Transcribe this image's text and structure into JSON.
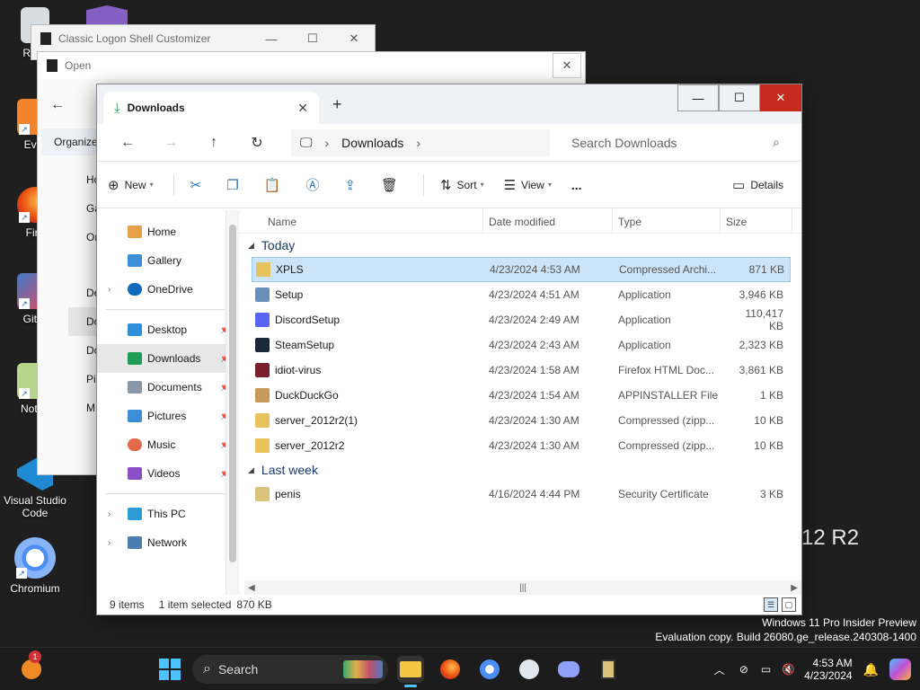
{
  "desktop": {
    "icons": [
      {
        "label": "Recy",
        "top": 0
      },
      {
        "label": "Ever",
        "top": 0
      },
      {
        "label": "Fire",
        "top": 0
      },
      {
        "label": "Git B",
        "top": 0
      },
      {
        "label": "Notep",
        "top": 0
      },
      {
        "label": "Visual Studio Code",
        "top": 0
      },
      {
        "label": "Chromium",
        "top": 0
      }
    ],
    "server_text": "12 R2"
  },
  "bg_windows": {
    "logon_title": "Classic Logon Shell Customizer",
    "open_title": "Open",
    "organize_label": "Organize",
    "open_sidebar": [
      "Ho",
      "Ga",
      "Or",
      "De",
      "Do",
      "Do",
      "Pi",
      "M"
    ]
  },
  "explorer": {
    "tab_title": "Downloads",
    "breadcrumb": "Downloads",
    "search_placeholder": "Search Downloads",
    "commands": {
      "new": "New",
      "sort": "Sort",
      "view": "View",
      "more": "...",
      "details": "Details"
    },
    "nav": {
      "home": "Home",
      "gallery": "Gallery",
      "onedrive": "OneDrive",
      "desktop": "Desktop",
      "downloads": "Downloads",
      "documents": "Documents",
      "pictures": "Pictures",
      "music": "Music",
      "videos": "Videos",
      "thispc": "This PC",
      "network": "Network"
    },
    "columns": {
      "name": "Name",
      "date": "Date modified",
      "type": "Type",
      "size": "Size"
    },
    "groups": {
      "today": "Today",
      "lastweek": "Last week"
    },
    "files_today": [
      {
        "name": "XPLS",
        "date": "4/23/2024 4:53 AM",
        "type": "Compressed Archi...",
        "size": "871 KB",
        "icon": "zip-folder-icon",
        "color": "#e8c25a",
        "selected": true
      },
      {
        "name": "Setup",
        "date": "4/23/2024 4:51 AM",
        "type": "Application",
        "size": "3,946 KB",
        "icon": "setup-icon",
        "color": "#6a8fb8",
        "selected": false
      },
      {
        "name": "DiscordSetup",
        "date": "4/23/2024 2:49 AM",
        "type": "Application",
        "size": "110,417 KB",
        "icon": "discord-icon",
        "color": "#5865f2",
        "selected": false
      },
      {
        "name": "SteamSetup",
        "date": "4/23/2024 2:43 AM",
        "type": "Application",
        "size": "2,323 KB",
        "icon": "steam-icon",
        "color": "#1b2838",
        "selected": false
      },
      {
        "name": "idiot-virus",
        "date": "4/23/2024 1:58 AM",
        "type": "Firefox HTML Doc...",
        "size": "3,861 KB",
        "icon": "firefox-html-icon",
        "color": "#7a1f2b",
        "selected": false
      },
      {
        "name": "DuckDuckGo",
        "date": "4/23/2024 1:54 AM",
        "type": "APPINSTALLER File",
        "size": "1 KB",
        "icon": "package-icon",
        "color": "#c49a5c",
        "selected": false
      },
      {
        "name": "server_2012r2(1)",
        "date": "4/23/2024 1:30 AM",
        "type": "Compressed (zipp...",
        "size": "10 KB",
        "icon": "zip-folder-icon",
        "color": "#e8c25a",
        "selected": false
      },
      {
        "name": "server_2012r2",
        "date": "4/23/2024 1:30 AM",
        "type": "Compressed (zipp...",
        "size": "10 KB",
        "icon": "zip-folder-icon",
        "color": "#e8c25a",
        "selected": false
      }
    ],
    "files_lastweek": [
      {
        "name": "penis",
        "date": "4/16/2024 4:44 PM",
        "type": "Security Certificate",
        "size": "3 KB",
        "icon": "certificate-icon",
        "color": "#d9c27a",
        "selected": false
      }
    ],
    "status": {
      "items": "9 items",
      "selected": "1 item selected",
      "size": "870 KB"
    }
  },
  "watermark": {
    "line1": "Windows 11 Pro Insider Preview",
    "line2": "Evaluation copy. Build 26080.ge_release.240308-1400"
  },
  "taskbar": {
    "search_label": "Search",
    "notification_count": "1",
    "time": "4:53 AM",
    "date": "4/23/2024"
  }
}
